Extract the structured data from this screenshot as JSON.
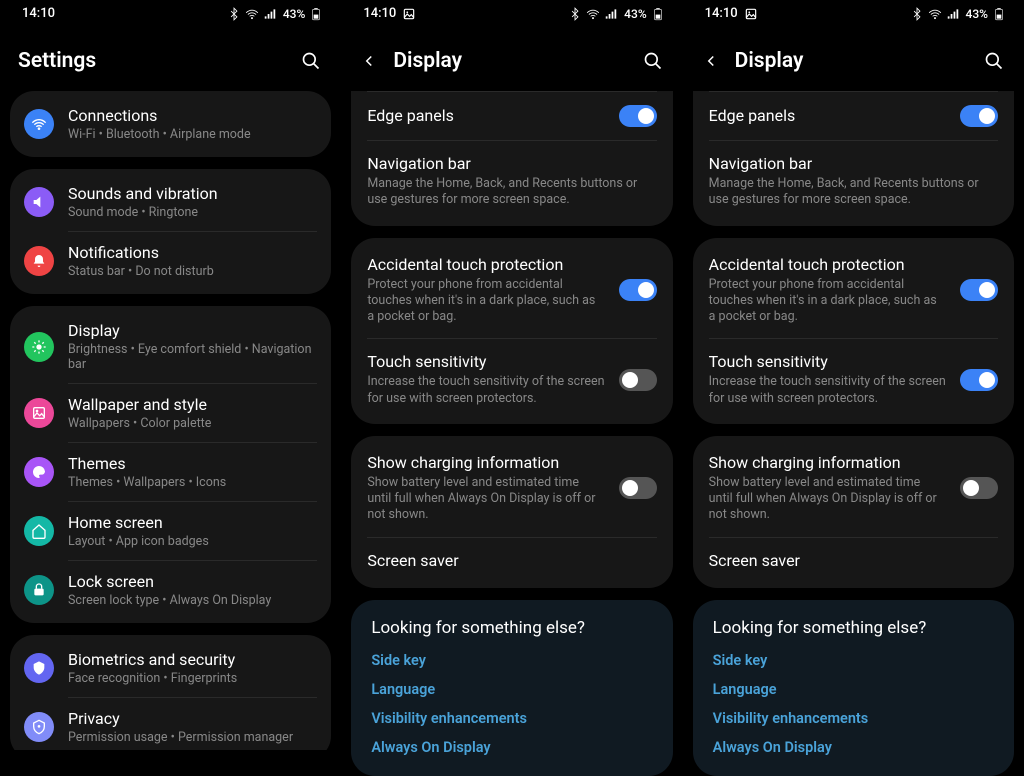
{
  "status": {
    "time": "14:10",
    "battery": "43%"
  },
  "panel1": {
    "title": "Settings",
    "groups": [
      [
        {
          "title": "Connections",
          "sub": "Wi-Fi  •  Bluetooth  •  Airplane mode"
        }
      ],
      [
        {
          "title": "Sounds and vibration",
          "sub": "Sound mode  •  Ringtone"
        },
        {
          "title": "Notifications",
          "sub": "Status bar  •  Do not disturb"
        }
      ],
      [
        {
          "title": "Display",
          "sub": "Brightness  •  Eye comfort shield  •  Navigation bar"
        },
        {
          "title": "Wallpaper and style",
          "sub": "Wallpapers  •  Color palette"
        },
        {
          "title": "Themes",
          "sub": "Themes  •  Wallpapers  •  Icons"
        },
        {
          "title": "Home screen",
          "sub": "Layout  •  App icon badges"
        },
        {
          "title": "Lock screen",
          "sub": "Screen lock type  •  Always On Display"
        }
      ],
      [
        {
          "title": "Biometrics and security",
          "sub": "Face recognition  •  Fingerprints"
        },
        {
          "title": "Privacy",
          "sub": "Permission usage  •  Permission manager"
        }
      ]
    ]
  },
  "panel2": {
    "title": "Display",
    "rows1": [
      {
        "title": "Edge panels",
        "desc": "",
        "toggle": "on"
      },
      {
        "title": "Navigation bar",
        "desc": "Manage the Home, Back, and Recents buttons or use gestures for more screen space.",
        "toggle": null
      }
    ],
    "rows2": [
      {
        "title": "Accidental touch protection",
        "desc": "Protect your phone from accidental touches when it's in a dark place, such as a pocket or bag.",
        "toggle": "on"
      },
      {
        "title": "Touch sensitivity",
        "desc": "Increase the touch sensitivity of the screen for use with screen protectors.",
        "toggle": "off"
      }
    ],
    "rows3": [
      {
        "title": "Show charging information",
        "desc": "Show battery level and estimated time until full when Always On Display is off or not shown.",
        "toggle": "off"
      },
      {
        "title": "Screen saver",
        "desc": "",
        "toggle": null
      }
    ],
    "looking": {
      "title": "Looking for something else?",
      "links": [
        "Side key",
        "Language",
        "Visibility enhancements",
        "Always On Display"
      ]
    }
  },
  "panel3": {
    "title": "Display",
    "rows1": [
      {
        "title": "Edge panels",
        "desc": "",
        "toggle": "on"
      },
      {
        "title": "Navigation bar",
        "desc": "Manage the Home, Back, and Recents buttons or use gestures for more screen space.",
        "toggle": null
      }
    ],
    "rows2": [
      {
        "title": "Accidental touch protection",
        "desc": "Protect your phone from accidental touches when it's in a dark place, such as a pocket or bag.",
        "toggle": "on"
      },
      {
        "title": "Touch sensitivity",
        "desc": "Increase the touch sensitivity of the screen for use with screen protectors.",
        "toggle": "on"
      }
    ],
    "rows3": [
      {
        "title": "Show charging information",
        "desc": "Show battery level and estimated time until full when Always On Display is off or not shown.",
        "toggle": "off"
      },
      {
        "title": "Screen saver",
        "desc": "",
        "toggle": null
      }
    ],
    "looking": {
      "title": "Looking for something else?",
      "links": [
        "Side key",
        "Language",
        "Visibility enhancements",
        "Always On Display"
      ]
    }
  }
}
